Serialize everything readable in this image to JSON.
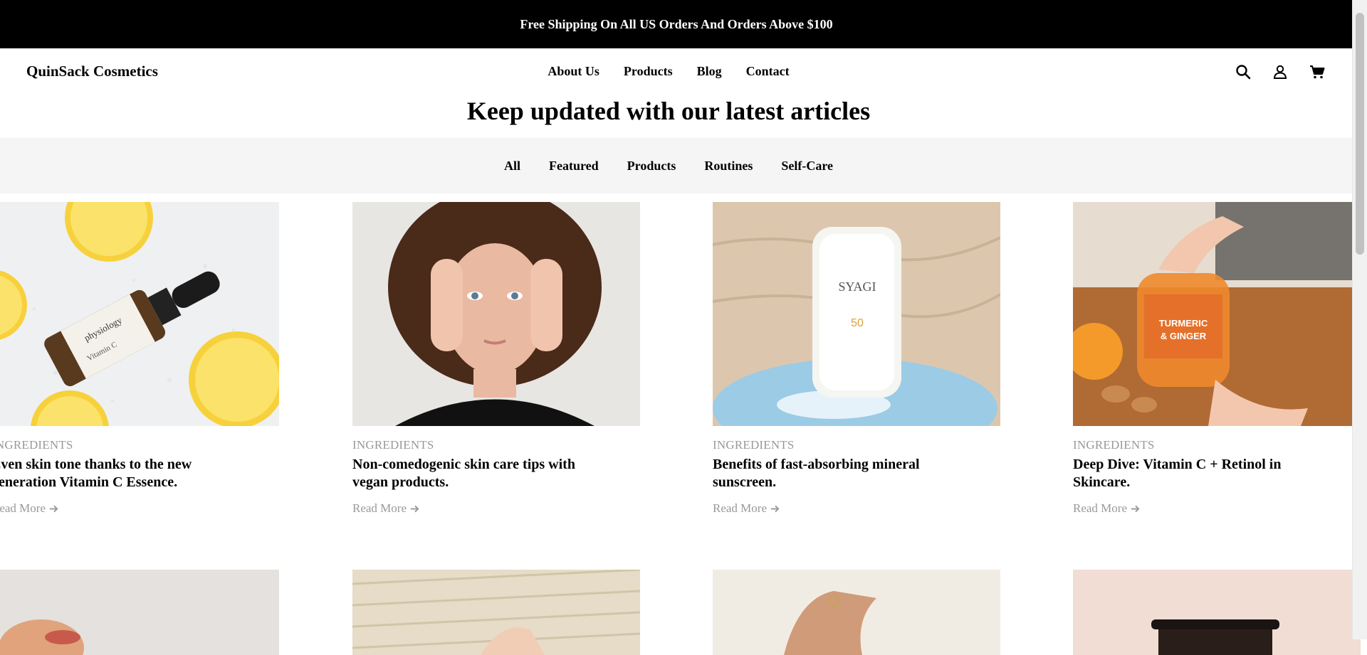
{
  "announcement": "Free Shipping On All US Orders And Orders Above $100",
  "brand": "QuinSack Cosmetics",
  "nav": [
    "About Us",
    "Products",
    "Blog",
    "Contact"
  ],
  "header_icons": [
    "search-icon",
    "account-icon",
    "cart-icon"
  ],
  "heading": "Keep updated with our latest articles",
  "filters": [
    "All",
    "Featured",
    "Products",
    "Routines",
    "Self-Care"
  ],
  "articles": [
    {
      "category": "INGREDIENTS",
      "title": "Even skin tone thanks to the new generation Vitamin C Essence.",
      "read_more": "Read More"
    },
    {
      "category": "INGREDIENTS",
      "title": "Non-comedogenic skin care tips with vegan products.",
      "read_more": "Read More"
    },
    {
      "category": "INGREDIENTS",
      "title": "Benefits of fast-absorbing mineral sunscreen.",
      "read_more": "Read More"
    },
    {
      "category": "INGREDIENTS",
      "title": "Deep Dive: Vitamin C + Retinol in Skincare.",
      "read_more": "Read More"
    }
  ],
  "image_text": {
    "serum_brand": "physiology",
    "serum_label": "Vitamin C",
    "sunscreen_brand": "SYAGI",
    "sunscreen_spf": "50",
    "jar_label_1": "TURMERIC",
    "jar_label_2": "& GINGER"
  }
}
